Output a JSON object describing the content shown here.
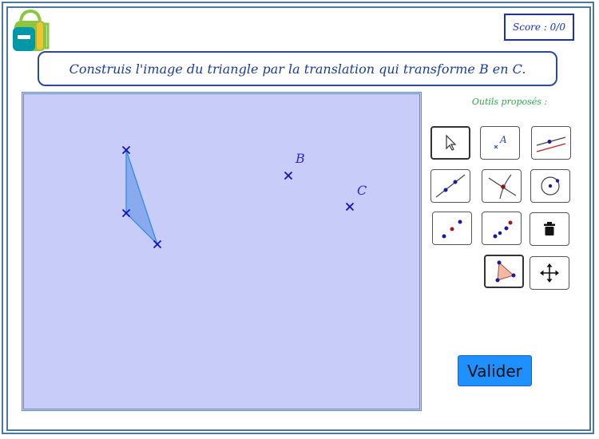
{
  "score": {
    "text": "Score : 0/0"
  },
  "instruction": {
    "text": "Construis l'image du triangle par la translation qui transforme B en C."
  },
  "canvas": {
    "point_labels": {
      "B": "B",
      "C": "C"
    }
  },
  "tools": {
    "title": "Outils proposés :",
    "items": [
      {
        "name": "move-tool",
        "icon": "pointer-arrow-icon"
      },
      {
        "name": "text-label-tool",
        "icon": "point-with-label-icon"
      },
      {
        "name": "parallel-line-tool",
        "icon": "parallel-line-icon"
      },
      {
        "name": "line-tool",
        "icon": "line-through-two-points-icon"
      },
      {
        "name": "intersection-tool",
        "icon": "intersect-two-objects-icon"
      },
      {
        "name": "circle-tool",
        "icon": "circle-center-point-icon"
      },
      {
        "name": "vector-tool",
        "icon": "vector-from-point-icon"
      },
      {
        "name": "translate-by-vector-tool",
        "icon": "translate-by-vector-icon"
      },
      {
        "name": "delete-tool",
        "icon": "trash-icon"
      },
      {
        "name": "polygon-tool",
        "icon": "polygon-icon"
      },
      {
        "name": "pan-tool",
        "icon": "move-cross-arrows-icon"
      }
    ]
  },
  "actions": {
    "validate_label": "Valider"
  },
  "colors": {
    "accent": "#1e90ff",
    "canvas_bg": "#c8ccf8",
    "point": "#1010c0",
    "title_green": "#2ea84a"
  }
}
